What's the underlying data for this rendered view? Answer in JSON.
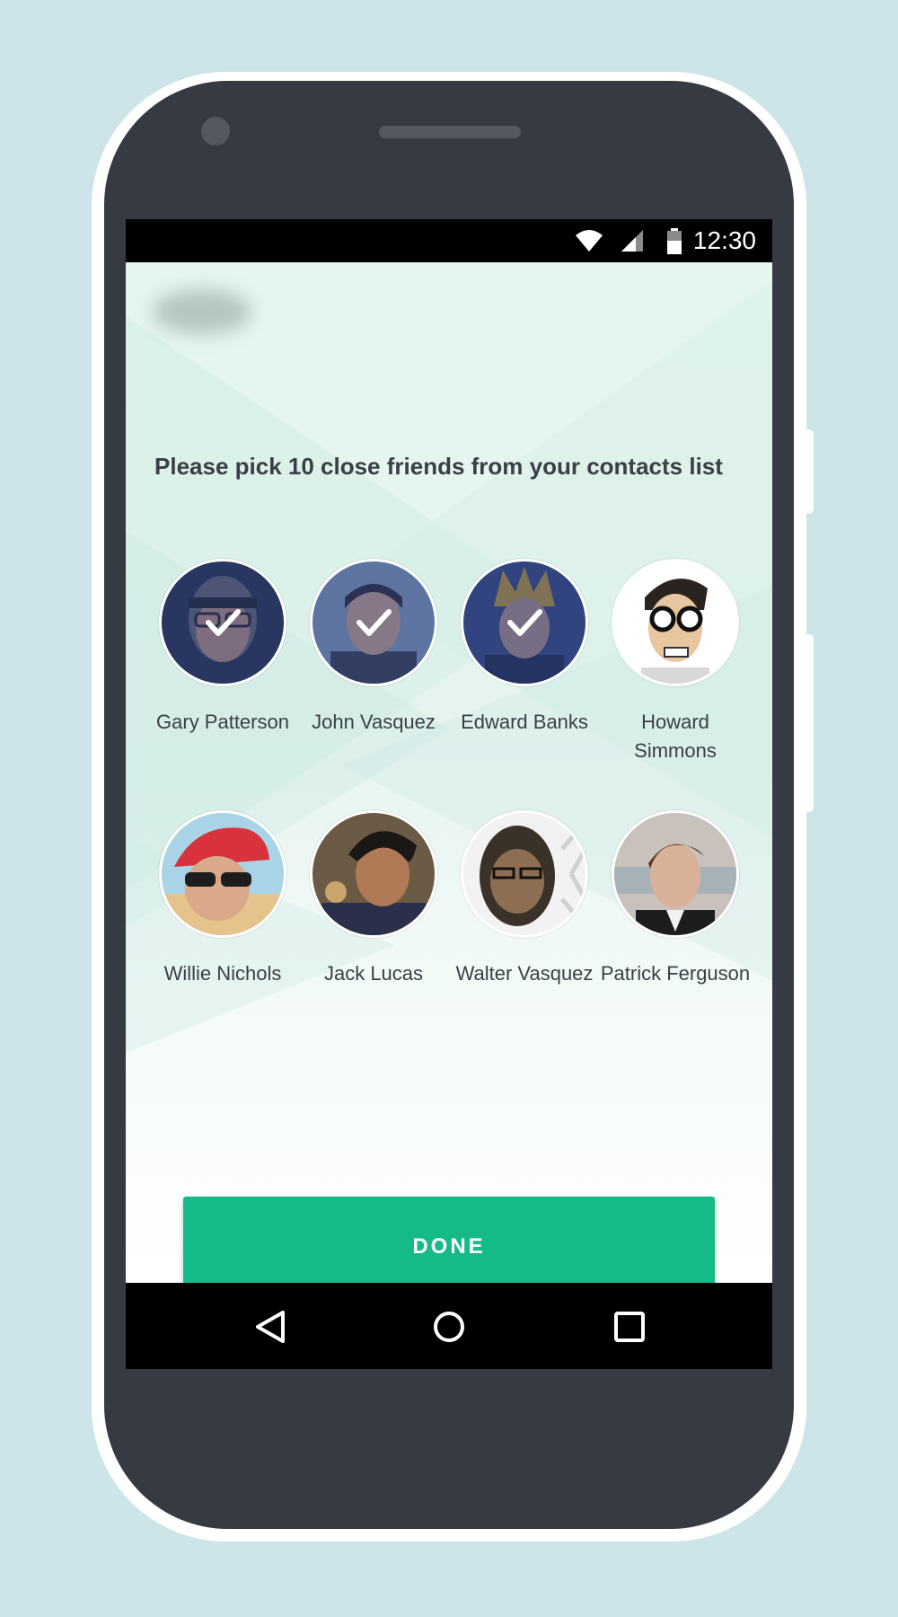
{
  "status_bar": {
    "time": "12:30",
    "icons": [
      "wifi-icon",
      "cellular-signal-icon",
      "battery-icon"
    ]
  },
  "instruction": "Please pick 10 close friends from your contacts list",
  "friends": [
    {
      "name": "Gary Patterson",
      "selected": true
    },
    {
      "name": "John Vasquez",
      "selected": true
    },
    {
      "name": "Edward Banks",
      "selected": true
    },
    {
      "name": "Howard Simmons",
      "selected": false
    },
    {
      "name": "Willie Nichols",
      "selected": false
    },
    {
      "name": "Jack Lucas",
      "selected": false
    },
    {
      "name": "Walter Vasquez",
      "selected": false
    },
    {
      "name": "Patrick Ferguson",
      "selected": false
    }
  ],
  "done_label": "DONE",
  "nav_bar": {
    "icons": [
      "back-icon",
      "home-icon",
      "recents-icon"
    ]
  },
  "colors": {
    "accent": "#14bb88",
    "phone_body": "#363a43",
    "page_background": "#cde5e8",
    "selected_overlay": "#28377a"
  }
}
